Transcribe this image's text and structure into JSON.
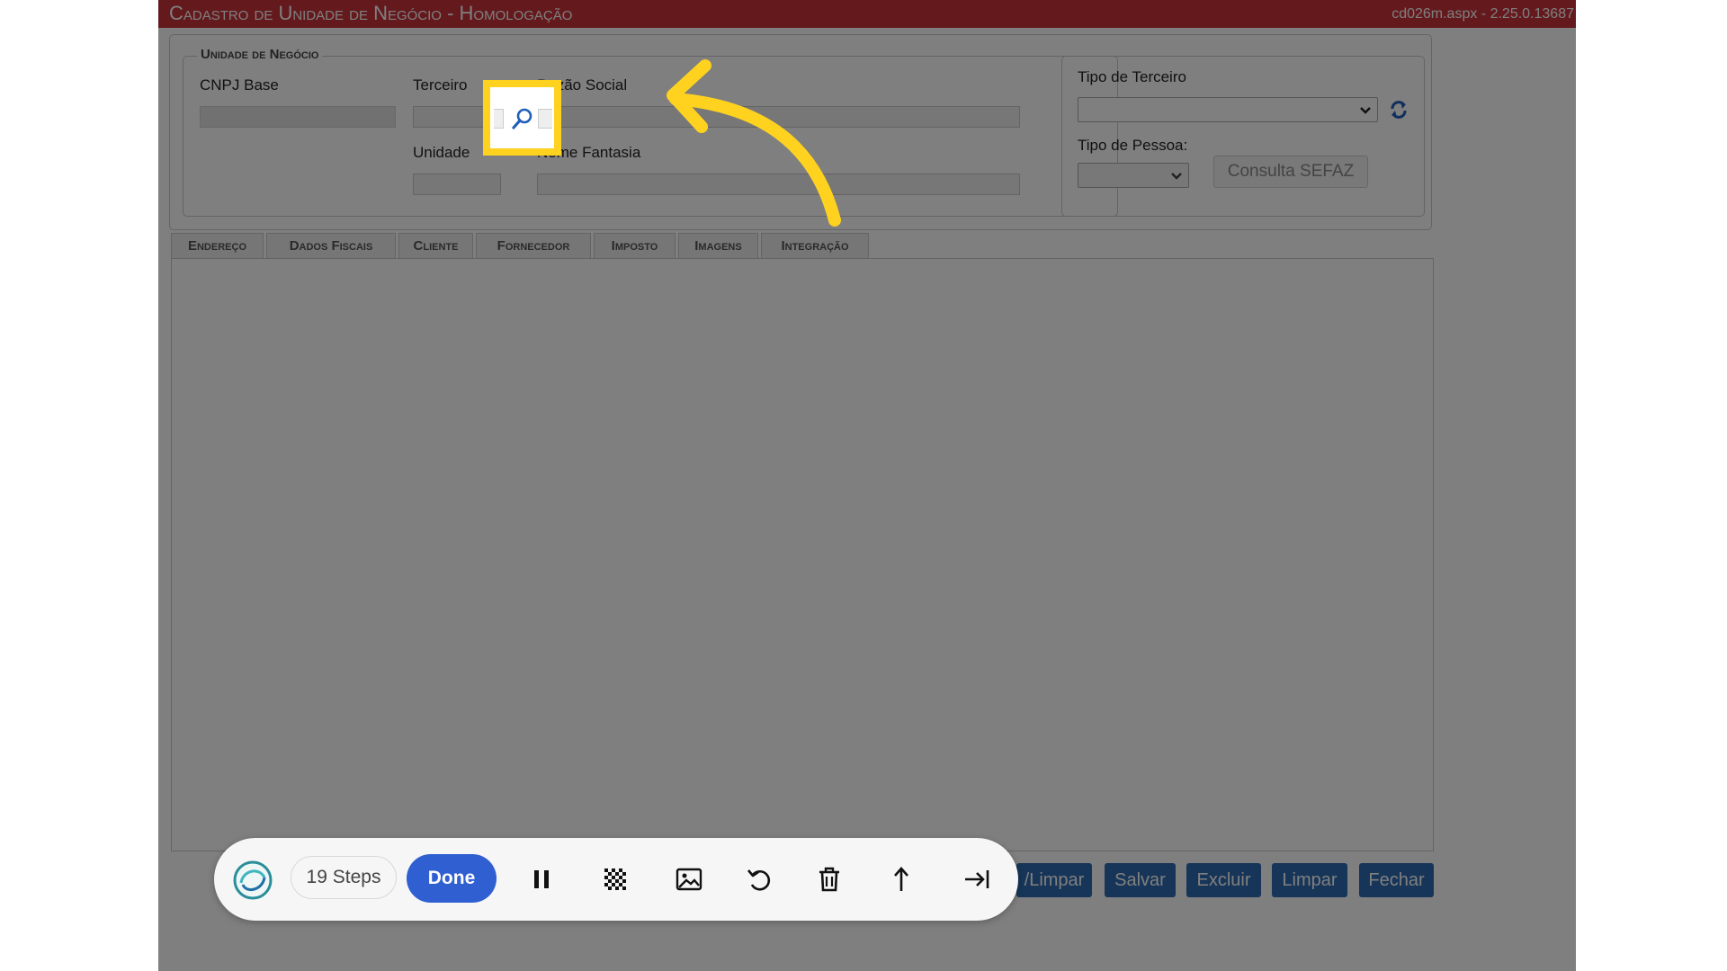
{
  "titlebar": {
    "title": "Cadastro de Unidade de Negócio  - Homologação",
    "version": "cd026m.aspx - 2.25.0.13687"
  },
  "unidade": {
    "legend": "Unidade de Negócio",
    "cnpj_label": "CNPJ Base",
    "terceiro_label": "Terceiro",
    "razao_label": "Razão Social",
    "unidade_label": "Unidade",
    "fantasia_label": "Nome Fantasia"
  },
  "tipo": {
    "terceiro_label": "Tipo de Terceiro",
    "pessoa_label": "Tipo de Pessoa:",
    "sefaz_label": "Consulta SEFAZ"
  },
  "tabs": [
    {
      "label": "Endereço"
    },
    {
      "label": "Dados Fiscais"
    },
    {
      "label": "Cliente"
    },
    {
      "label": "Fornecedor"
    },
    {
      "label": "Imposto"
    },
    {
      "label": "Imagens"
    },
    {
      "label": "Integração"
    }
  ],
  "actions": {
    "salvar_limpar": "/Limpar",
    "salvar": "Salvar",
    "excluir": "Excluir",
    "limpar": "Limpar",
    "fechar": "Fechar"
  },
  "recorder": {
    "steps_label": "19 Steps",
    "done_label": "Done"
  },
  "colors": {
    "titlebar": "#c8333b",
    "button": "#2e6bb0",
    "highlight": "#ffd21f",
    "done": "#2f5fd1"
  },
  "icons": {
    "lookup": "magnifier-icon",
    "refresh": "refresh-icon",
    "annotation": "curved-arrow-icon"
  }
}
